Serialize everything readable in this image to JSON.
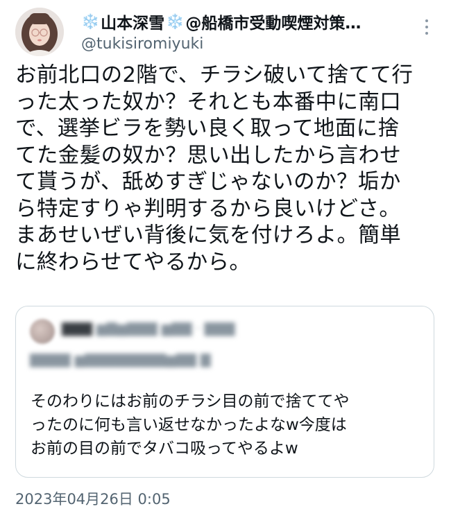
{
  "author": {
    "display_name_left_emoji": "❄️",
    "display_name": "山本深雪",
    "display_name_right_emoji": "❄️",
    "display_name_suffix": "@船橋市受動喫煙対策…",
    "handle": "@tukisiromiyuki",
    "avatar_icon": "avatar-photo"
  },
  "tweet": {
    "text": "お前北口の2階で、チラシ破いて捨てて行\nった太った奴か？それとも本番中に南口\nで、選挙ビラを勢い良く取って地面に捨\nてた金髪の奴か？思い出したから言わせ\nて貰うが、舐めすぎじゃないのか？垢か\nら特定すりゃ判明するから良いけどさ。\nまあせいぜい背後に気を付けろよ。簡単\nに終わらせてやるから。",
    "timestamp": "2023年04月26日 0:05"
  },
  "quoted_tweet": {
    "author_blurred": "",
    "handle_blurred": "",
    "reply_line_blurred": "",
    "text": "そのわりにはお前のチラシ目の前で捨ててや\nったのに何も言い返せなかったよなw今度は\nお前の目の前でタバコ吸ってやるよw"
  },
  "icons": {
    "more": "more-vertical-icon",
    "snowflake": "snowflake-icon"
  },
  "colors": {
    "text": "#0f1419",
    "secondary_text": "#536471",
    "border": "#cfd9de",
    "snowflake": "#7ab6e6"
  }
}
